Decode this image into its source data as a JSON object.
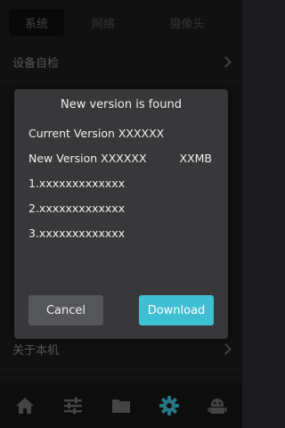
{
  "tabs": [
    {
      "label": "系统"
    },
    {
      "label": "网络"
    },
    {
      "label": "摄像头"
    }
  ],
  "settings": {
    "items": [
      {
        "label": "设备自检"
      },
      {
        "label": "关于本机"
      }
    ]
  },
  "dialog": {
    "title": "New version is found",
    "current_version": "Current Version XXXXXX",
    "new_version": "New Version XXXXXX",
    "size": "XXMB",
    "notes": [
      "1.xxxxxxxxxxxxx",
      "2.xxxxxxxxxxxxx",
      "3.xxxxxxxxxxxxx"
    ],
    "cancel_label": "Cancel",
    "download_label": "Download"
  },
  "bottom_nav": [
    {
      "icon": "home-icon"
    },
    {
      "icon": "sliders-icon"
    },
    {
      "icon": "folder-icon"
    },
    {
      "icon": "gear-icon",
      "active": true
    },
    {
      "icon": "robot-icon"
    }
  ],
  "colors": {
    "accent": "#3fbfd3",
    "background": "#1c1c1e",
    "dialog": "#38383a",
    "cancel_button": "#55565a"
  }
}
